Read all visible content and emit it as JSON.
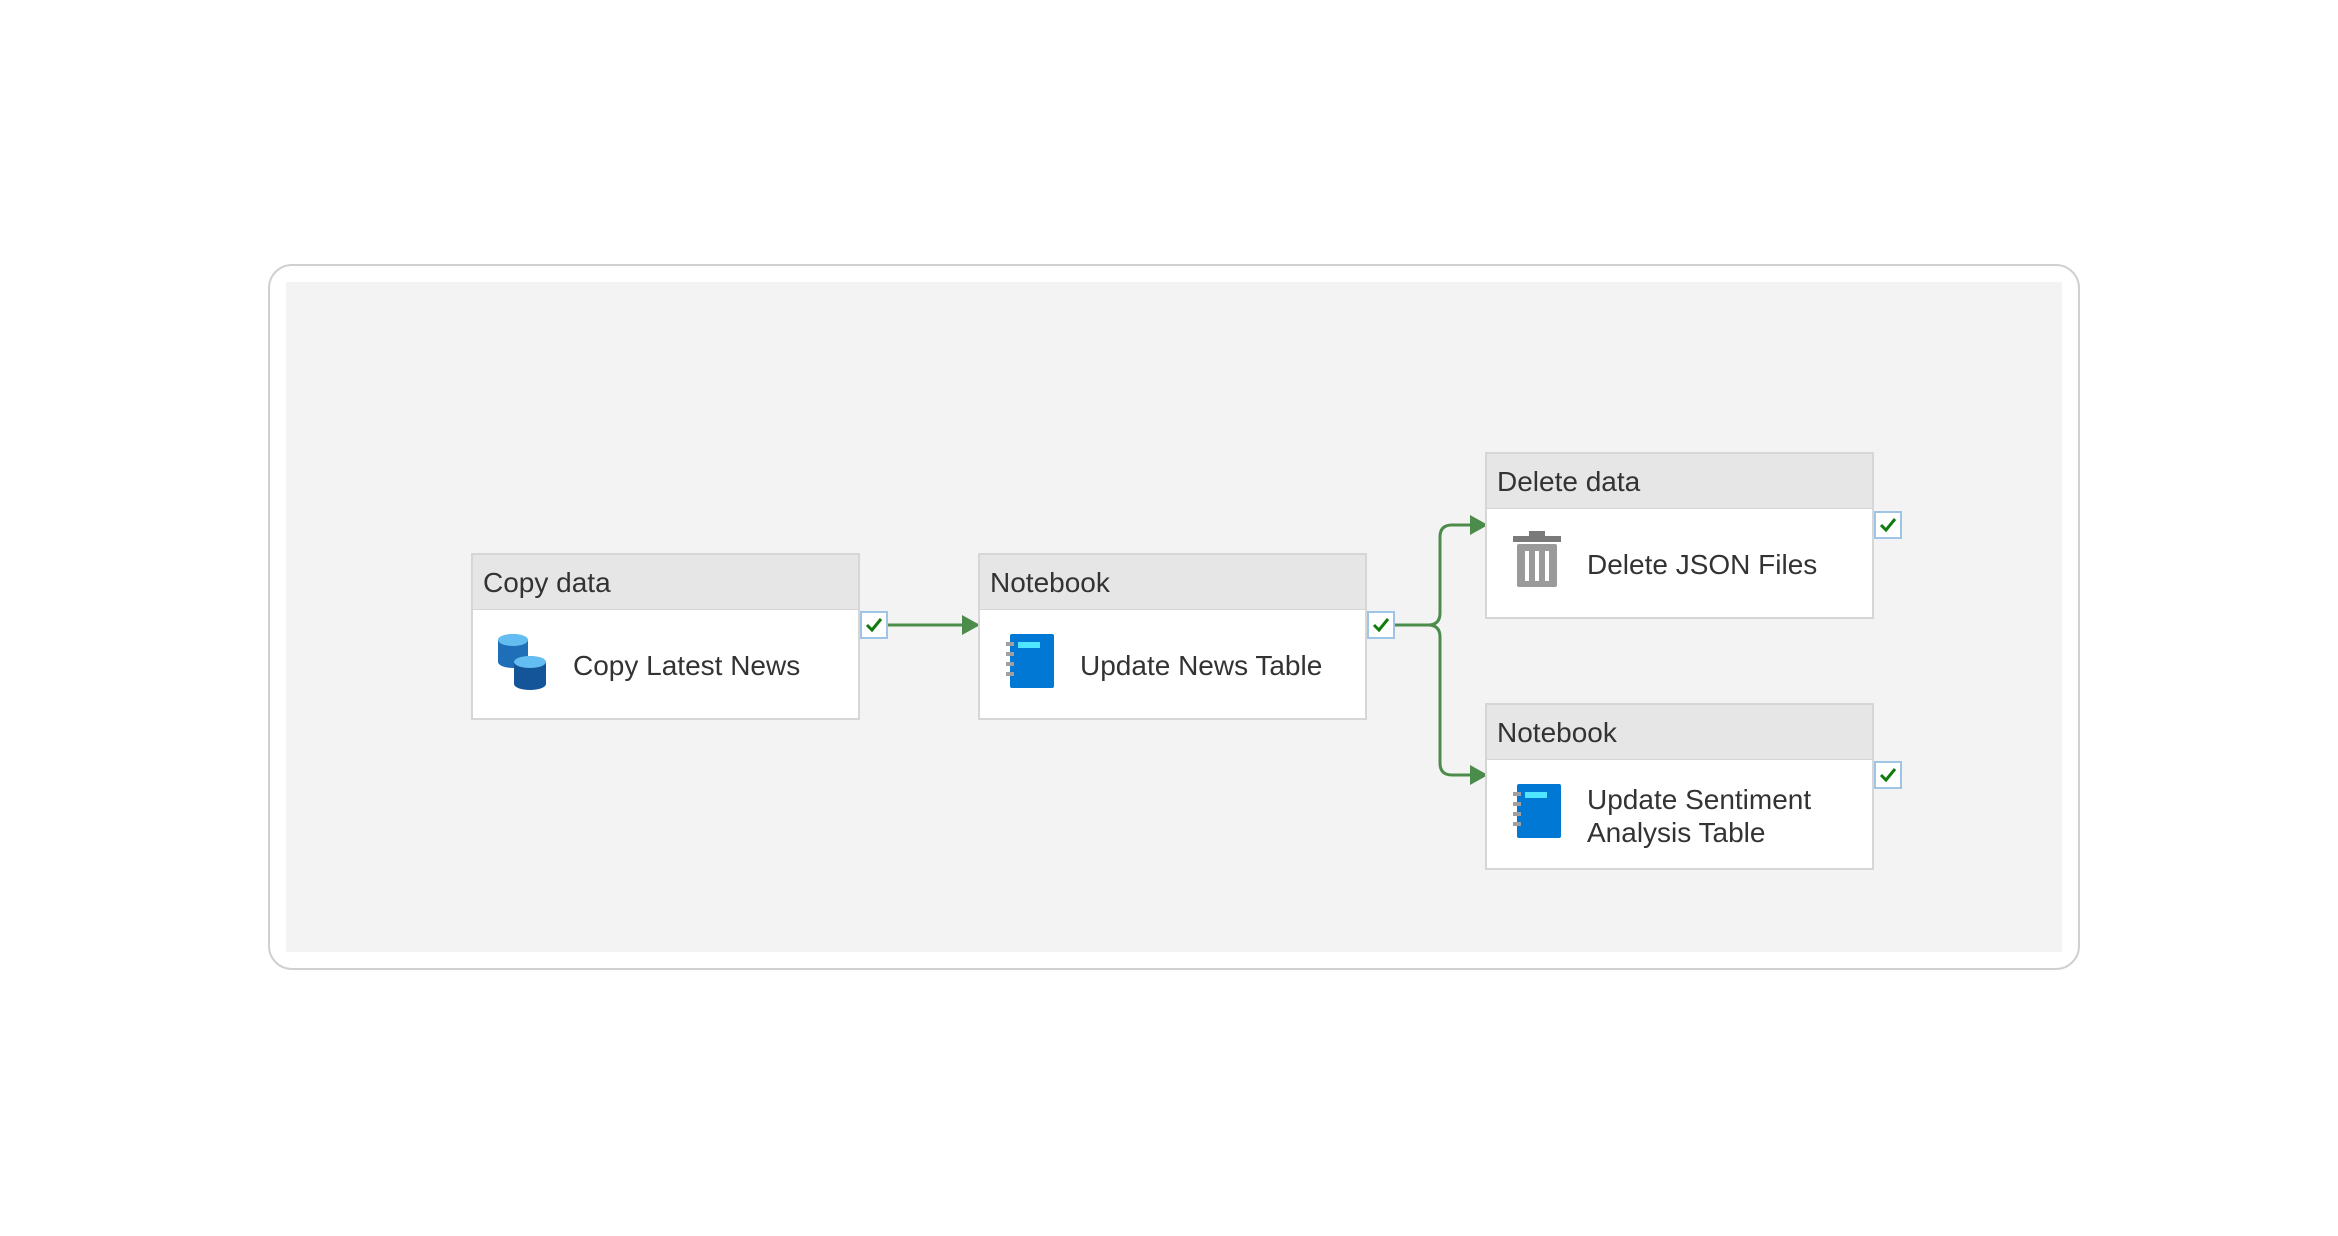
{
  "activities": [
    {
      "id": "copy",
      "type_label": "Copy data",
      "name_line1": "Copy Latest News",
      "name_line2": "",
      "icon": "database-copy-icon"
    },
    {
      "id": "nb1",
      "type_label": "Notebook",
      "name_line1": "Update News Table",
      "name_line2": "",
      "icon": "notebook-icon"
    },
    {
      "id": "del",
      "type_label": "Delete data",
      "name_line1": "Delete JSON Files",
      "name_line2": "",
      "icon": "trash-icon"
    },
    {
      "id": "nb2",
      "type_label": "Notebook",
      "name_line1": "Update Sentiment",
      "name_line2": "Analysis Table",
      "icon": "notebook-icon"
    }
  ],
  "colors": {
    "connector": "#4c8c4a",
    "notebook_blue": "#0078d4",
    "check_green": "#107c10",
    "canvas": "#f3f3f3"
  }
}
